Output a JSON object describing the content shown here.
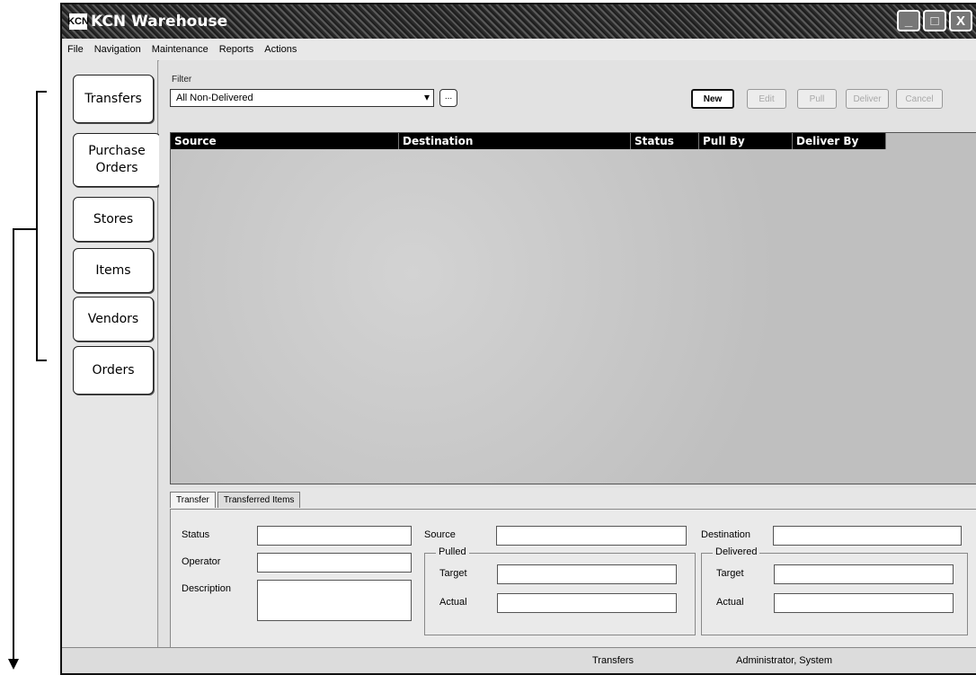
{
  "app": {
    "logo_text": "KCN",
    "title": "KCN Warehouse",
    "window_controls": {
      "minimize": "_",
      "maximize": "□",
      "close": "X"
    }
  },
  "menu": [
    {
      "label": "File"
    },
    {
      "label": "Navigation"
    },
    {
      "label": "Maintenance"
    },
    {
      "label": "Reports"
    },
    {
      "label": "Actions"
    }
  ],
  "nav": [
    {
      "label": "Transfers"
    },
    {
      "label": "Purchase Orders"
    },
    {
      "label": "Stores"
    },
    {
      "label": "Items"
    },
    {
      "label": "Vendors"
    },
    {
      "label": "Orders"
    }
  ],
  "filter": {
    "label": "Filter",
    "value": "All Non-Delivered",
    "more": "..."
  },
  "toolbar": {
    "new": "New",
    "edit": "Edit",
    "pull": "Pull",
    "deliver": "Deliver",
    "cancel": "Cancel"
  },
  "grid": {
    "columns": [
      "Source",
      "Destination",
      "Status",
      "Pull By",
      "Deliver By"
    ],
    "rows": []
  },
  "details": {
    "tabs": [
      "Transfer",
      "Transferred Items"
    ],
    "status_label": "Status",
    "operator_label": "Operator",
    "description_label": "Description",
    "source_label": "Source",
    "destination_label": "Destination",
    "pulled_group": "Pulled",
    "delivered_group": "Delivered",
    "target_label": "Target",
    "actual_label": "Actual"
  },
  "statusbar": {
    "module": "Transfers",
    "user": "Administrator, System"
  }
}
